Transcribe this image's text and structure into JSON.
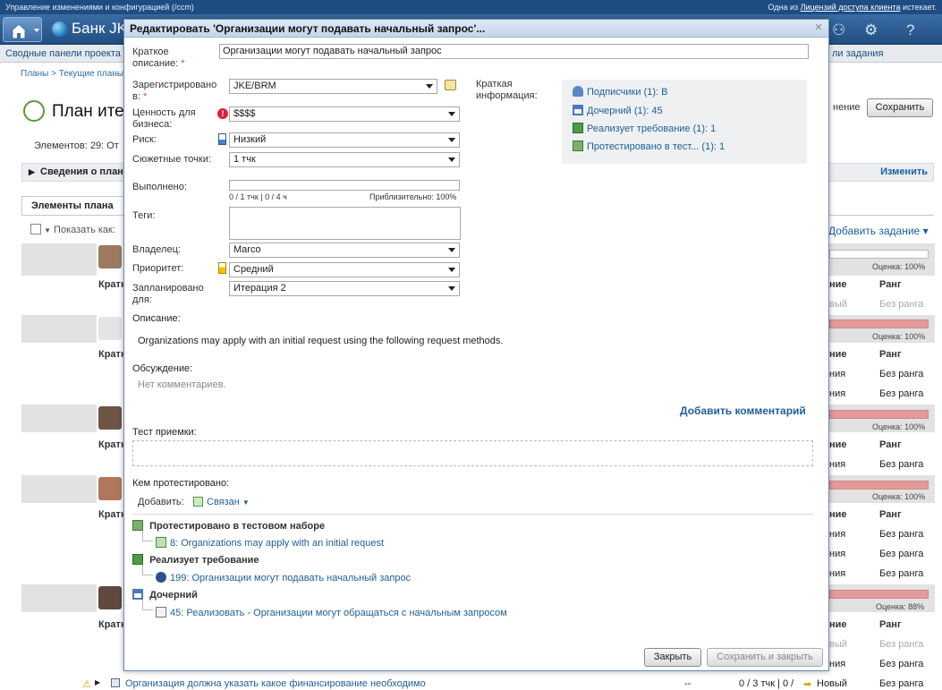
{
  "top": {
    "left_text": "Управление изменениями и конфигурацией (/ccm)",
    "right_pre": "Одна из",
    "right_link": "Лицензий доступа клиента",
    "right_post": "истекает."
  },
  "banner": {
    "project": "Банк JK"
  },
  "menu": {
    "item1": "Сводные панели проекта",
    "right": "ли задания"
  },
  "crumb": "Планы > Текущие планы",
  "page": {
    "title": "План итер",
    "elements": "Элементов: 29:  От",
    "save_label": "Сохранить",
    "change_partial": "нение"
  },
  "plan": {
    "section": "Сведения о план",
    "edit_link": "Изменить",
    "tab": "Элементы плана",
    "show_as": "Показать как:",
    "add_task": "Добавить задание"
  },
  "bg_table": {
    "headers": {
      "summary": "Кратк",
      "state": "ние",
      "rank": "Ранг"
    },
    "estimates": [
      "Оценка: 100%",
      "Оценка: 100%",
      "Оценка: 100%",
      "Оценка: 100%",
      "Оценка: 88%"
    ],
    "state_new": "Новый",
    "state_new_partial": "вый",
    "state_partial": "ния",
    "rank": "Без ранга",
    "bottom_row": {
      "summary": "Организация должна указать какое финансирование необходимо",
      "dash": "--",
      "points": "0 / 3 тчк | 0 /",
      "state": "Новый",
      "rank": "Без ранга"
    }
  },
  "dialog": {
    "title": "Редактировать 'Организации могут подавать начальный запрос'...",
    "summary_label": "Краткое описание:",
    "summary_value": "Организации могут подавать начальный запрос",
    "filed_label": "Зарегистрировано в:",
    "filed_value": "JKE/BRM",
    "value_label": "Ценность для бизнеса:",
    "value_value": "$$$$",
    "risk_label": "Риск:",
    "risk_value": "Низкий",
    "points_label": "Сюжетные точки:",
    "points_value": "1 тчк",
    "done_label": "Выполнено:",
    "done_left": "0 / 1 тчк | 0 / 4 ч",
    "done_right": "Приблизительно: 100%",
    "tags_label": "Теги:",
    "owner_label": "Владелец:",
    "owner_value": "Marco",
    "priority_label": "Приоритет:",
    "priority_value": "Средний",
    "planned_label": "Запланировано для:",
    "planned_value": "Итерация 2",
    "brief_label": "Краткая информация:",
    "brief": [
      "Подписчики (1):  B",
      "Дочерний (1):  45",
      "Реализует требование (1):  1",
      "Протестировано в тест... (1):  1"
    ],
    "desc_label": "Описание:",
    "desc_text": "Organizations may apply with an initial request using the following request methods.",
    "discussion_label": "Обсуждение:",
    "no_comments": "Нет комментариев.",
    "add_comment": "Добавить комментарий",
    "acceptance_label": "Тест приемки:",
    "tested_by_label": "Кем протестировано:",
    "add_label": "Добавить:",
    "linked_label": "Связан",
    "groups": [
      {
        "title": "Протестировано в тестовом наборе",
        "item": "8: Organizations may apply with an initial request"
      },
      {
        "title": "Реализует требование",
        "item": "199: Организации могут подавать начальный запрос"
      },
      {
        "title": "Дочерний",
        "item": "45: Реализовать - Организации могут обращаться с начальным запросом"
      }
    ],
    "close_btn": "Закрыть",
    "save_close_btn": "Сохранить и закрыть"
  },
  "colors": {
    "accent": "#1f5e99",
    "banner": "#2f5f96",
    "estimate_bar": "#e59a9a"
  }
}
